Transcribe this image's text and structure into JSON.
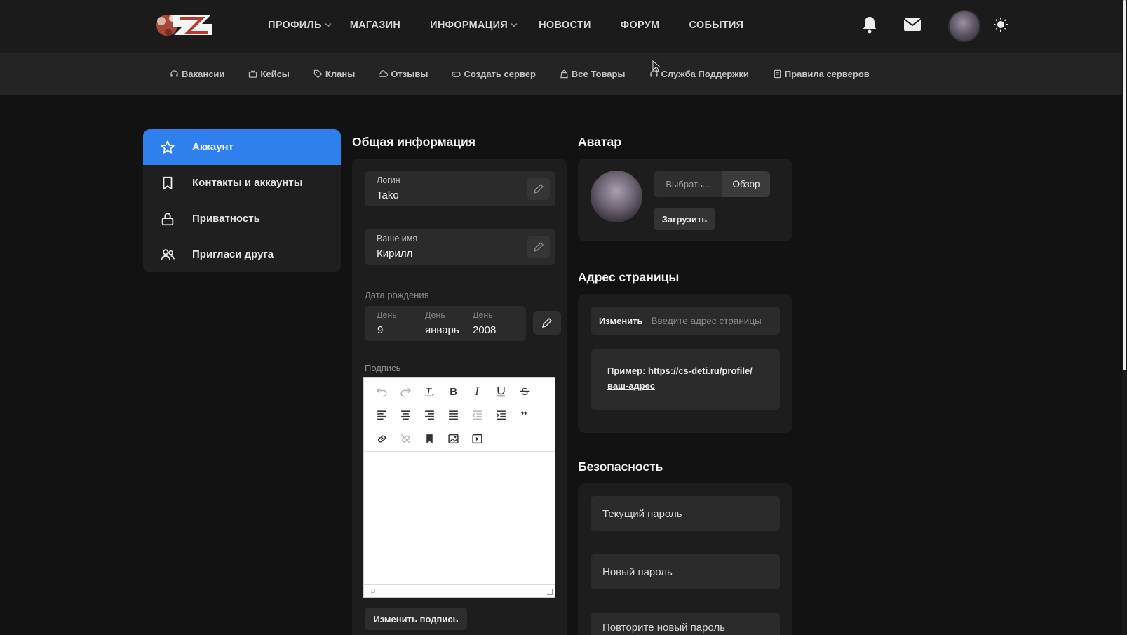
{
  "nav": {
    "items": [
      {
        "label": "ПРОФИЛЬ",
        "dropdown": true
      },
      {
        "label": "МАГАЗИН",
        "dropdown": false
      },
      {
        "label": "ИНФОРМАЦИЯ",
        "dropdown": true
      },
      {
        "label": "НОВОСТИ",
        "dropdown": false
      },
      {
        "label": "ФОРУМ",
        "dropdown": false
      },
      {
        "label": "СОБЫТИЯ",
        "dropdown": false
      }
    ]
  },
  "subnav": {
    "items": [
      {
        "label": "Вакансии",
        "icon": "headset-icon"
      },
      {
        "label": "Кейсы",
        "icon": "case-icon"
      },
      {
        "label": "Кланы",
        "icon": "tag-icon"
      },
      {
        "label": "Отзывы",
        "icon": "cloud-icon"
      },
      {
        "label": "Создать сервер",
        "icon": "gamepad-icon"
      },
      {
        "label": "Все Товары",
        "icon": "bag-icon"
      },
      {
        "label": "Служба Поддержки",
        "icon": "support-icon"
      },
      {
        "label": "Правила серверов",
        "icon": "document-icon"
      }
    ]
  },
  "sidebar": {
    "items": [
      {
        "label": "Аккаунт",
        "icon": "star-icon",
        "active": true
      },
      {
        "label": "Контакты и аккаунты",
        "icon": "bookmark-icon",
        "active": false
      },
      {
        "label": "Приватность",
        "icon": "lock-icon",
        "active": false
      },
      {
        "label": "Пригласи друга",
        "icon": "users-icon",
        "active": false
      }
    ]
  },
  "general": {
    "title": "Общая информация",
    "login": {
      "label": "Логин",
      "value": "Tako"
    },
    "name": {
      "label": "Ваше имя",
      "value": "Кирилл"
    },
    "birthday": {
      "label": "Дата рождения",
      "day": {
        "label": "День",
        "value": "9"
      },
      "month": {
        "label": "День",
        "value": "январь"
      },
      "year": {
        "label": "День",
        "value": "2008"
      }
    },
    "signature": {
      "label": "Подпись",
      "status_path": "p",
      "button": "Изменить подпись"
    }
  },
  "avatar": {
    "title": "Аватар",
    "pick_label": "Выбрать...",
    "browse_label": "Обзор",
    "upload_label": "Загрузить"
  },
  "address": {
    "title": "Адрес страницы",
    "change_label": "Изменить",
    "placeholder": "Введите адрес страницы",
    "example_prefix": "Пример: https://cs-deti.ru/profile/",
    "example_link": "ваш-адрес"
  },
  "security": {
    "title": "Безопасность",
    "current_password": "Текущий пароль",
    "new_password": "Новый пароль",
    "repeat_password": "Повторите новый пароль"
  },
  "colors": {
    "accent": "#2f80ed",
    "background": "#121212",
    "panel": "#1d1d1d"
  }
}
